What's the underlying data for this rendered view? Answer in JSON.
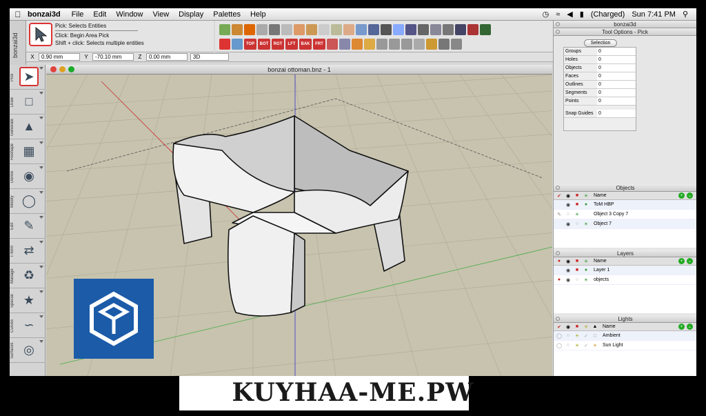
{
  "menubar": {
    "app_name": "bonzai3d",
    "menus": [
      "File",
      "Edit",
      "Window",
      "View",
      "Display",
      "Palettes",
      "Help"
    ],
    "battery": "(Charged)",
    "clock": "Sun 7:41 PM"
  },
  "pick": {
    "strip_title": "bonzai3d",
    "title": "Pick:  Selects Entities",
    "hint1": "Click: Begin Area Pick",
    "hint2": "Shift + click: Selects multiple entities"
  },
  "toolbar": {
    "views": [
      "TOP",
      "BOT",
      "RGT",
      "LFT",
      "BAK",
      "FRT"
    ]
  },
  "coords": {
    "x_label": "X",
    "x_value": "0.90 mm",
    "y_label": "Y",
    "y_value": "-70.10 mm",
    "z_label": "Z",
    "z_value": "0.00 mm",
    "mode": "3D"
  },
  "palette": {
    "tools": [
      "Pick",
      "Draw",
      "Generate",
      "Reshape",
      "Derive",
      "Modify",
      "Edit",
      "T-form",
      "Manage",
      "Special",
      "Curves",
      "Surfaces"
    ]
  },
  "window": {
    "title": "bonzai ottoman.bnz - 1"
  },
  "right": {
    "app_title": "bonzai3d",
    "tool_options_title": "Tool Options - Pick",
    "selection_button": "Selection",
    "selection_rows": [
      {
        "k": "Groups",
        "v": "0"
      },
      {
        "k": "Holes",
        "v": "0"
      },
      {
        "k": "Objects",
        "v": "0"
      },
      {
        "k": "Faces",
        "v": "0"
      },
      {
        "k": "Outlines",
        "v": "0"
      },
      {
        "k": "Segments",
        "v": "0"
      },
      {
        "k": "Points",
        "v": "0"
      }
    ],
    "snap_label": "Snap Guides",
    "snap_value": "0",
    "objects_title": "Objects",
    "objects_header": "Name",
    "objects": [
      "ToM HBP",
      "Object 3 Copy 7",
      "Object 7"
    ],
    "layers_title": "Layers",
    "layers_header": "Name",
    "layers": [
      "Layer 1",
      "objects"
    ],
    "lights_title": "Lights",
    "lights_header": "Name",
    "lights": [
      "Ambient",
      "Sun Light"
    ]
  },
  "watermark": "KUYHAA-ME.PW",
  "colors": {
    "viewport": "#c7c3ae",
    "grid": "#b3ae98",
    "logo": "#1b5ba8",
    "accent_red": "#d33333"
  }
}
